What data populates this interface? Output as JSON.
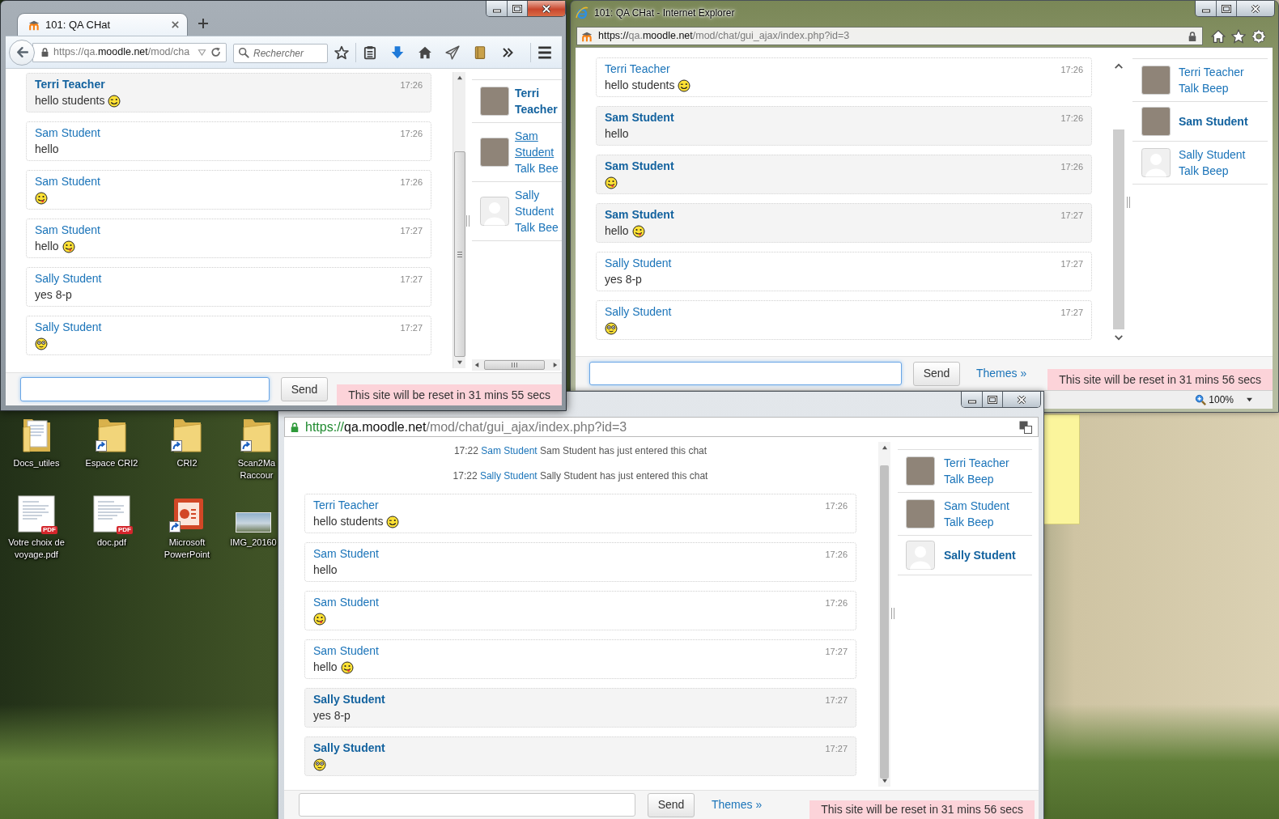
{
  "desktop": {
    "icons": [
      {
        "label": "Docs_utiles",
        "kind": "folder"
      },
      {
        "label": "Espace CRI2",
        "kind": "folder-shortcut"
      },
      {
        "label": "CRI2",
        "kind": "folder-shortcut"
      },
      {
        "label": "Scan2Ma Raccour",
        "kind": "folder-shortcut"
      },
      {
        "label": "Votre choix de voyage.pdf",
        "kind": "pdf",
        "badge": "PDF"
      },
      {
        "label": "doc.pdf",
        "kind": "pdf",
        "badge": "PDF"
      },
      {
        "label": "Microsoft PowerPoint",
        "kind": "presentation-shortcut"
      },
      {
        "label": "IMG_20160",
        "kind": "image"
      }
    ]
  },
  "windows": [
    {
      "kind": "firefox",
      "active": true,
      "tab_title": "101: QA CHat",
      "url": [
        {
          "text": "https://qa.",
          "kind": "dim"
        },
        {
          "text": "moodle.net",
          "kind": "strong"
        },
        {
          "text": "/mod/cha",
          "kind": "dim"
        }
      ],
      "search_placeholder": "Rechercher",
      "messages": [
        {
          "kind": "message",
          "author": "Terri Teacher",
          "time": "17:26",
          "text": "hello students",
          "emoji": {
            "kind": "wink"
          },
          "own": true
        },
        {
          "kind": "message",
          "author": "Sam Student",
          "time": "17:26",
          "text": "hello",
          "own": false
        },
        {
          "kind": "message",
          "author": "Sam Student",
          "time": "17:26",
          "emoji": {
            "kind": "tongue"
          },
          "own": false
        },
        {
          "kind": "message",
          "author": "Sam Student",
          "time": "17:27",
          "text": "hello",
          "emoji": {
            "kind": "tongue"
          },
          "own": false
        },
        {
          "kind": "message",
          "author": "Sally Student",
          "time": "17:27",
          "text": "yes 8-p",
          "own": false
        },
        {
          "kind": "message",
          "author": "Sally Student",
          "time": "17:27",
          "emoji": {
            "kind": "wide-eyed"
          },
          "own": false
        }
      ],
      "users": [
        {
          "name": "Terri Teacher",
          "avatar": {
            "kind": "photo"
          },
          "own": true,
          "hovered": false
        },
        {
          "name": "Sam Student",
          "avatar": {
            "kind": "photo"
          },
          "own": false,
          "hovered": true,
          "actions": [
            "Talk",
            "Bee"
          ]
        },
        {
          "name": "Sally Student",
          "avatar": {
            "kind": "default"
          },
          "own": false,
          "hovered": false,
          "actions": [
            "Talk",
            "Bee"
          ]
        }
      ],
      "input": {
        "focused": true
      },
      "send_label": "Send",
      "reset_notice": "This site will be reset in 31 mins 55 secs"
    },
    {
      "kind": "ie",
      "active": false,
      "title": "101: QA CHat - Internet Explorer",
      "url": [
        {
          "text": "https://",
          "kind": "strong"
        },
        {
          "text": "qa.",
          "kind": "dim"
        },
        {
          "text": "moodle.net",
          "kind": "strong"
        },
        {
          "text": "/mod/chat/gui_ajax/index.php?id=3",
          "kind": "dim"
        }
      ],
      "messages": [
        {
          "kind": "message",
          "author": "Terri Teacher",
          "time": "17:26",
          "text": "hello students",
          "emoji": {
            "kind": "wink"
          },
          "own": false
        },
        {
          "kind": "message",
          "author": "Sam Student",
          "time": "17:26",
          "text": "hello",
          "own": true
        },
        {
          "kind": "message",
          "author": "Sam Student",
          "time": "17:26",
          "emoji": {
            "kind": "tongue"
          },
          "own": true
        },
        {
          "kind": "message",
          "author": "Sam Student",
          "time": "17:27",
          "text": "hello",
          "emoji": {
            "kind": "tongue"
          },
          "own": true
        },
        {
          "kind": "message",
          "author": "Sally Student",
          "time": "17:27",
          "text": "yes 8-p",
          "own": false
        },
        {
          "kind": "message",
          "author": "Sally Student",
          "time": "17:27",
          "emoji": {
            "kind": "wide-eyed"
          },
          "own": false
        }
      ],
      "users": [
        {
          "name": "Terri Teacher",
          "avatar": {
            "kind": "photo"
          },
          "own": false,
          "actions": [
            "Talk",
            "Beep"
          ]
        },
        {
          "name": "Sam Student",
          "avatar": {
            "kind": "photo"
          },
          "own": true
        },
        {
          "name": "Sally Student",
          "avatar": {
            "kind": "default"
          },
          "own": false,
          "actions": [
            "Talk",
            "Beep"
          ]
        }
      ],
      "input": {
        "focused": true
      },
      "send_label": "Send",
      "themes_link": "Themes »",
      "reset_notice": "This site will be reset in 31 mins 56 secs",
      "zoom_level": "100%"
    },
    {
      "kind": "chrome",
      "active": false,
      "url": [
        {
          "text": "https://",
          "kind": "secure"
        },
        {
          "text": "qa.moodle.net",
          "kind": "strong"
        },
        {
          "text": "/mod/chat/gui_ajax/index.php?id=3",
          "kind": "dim"
        }
      ],
      "messages": [
        {
          "kind": "system",
          "time": "17:22",
          "user": "Sam Student",
          "text": "Sam Student has just entered this chat"
        },
        {
          "kind": "system",
          "time": "17:22",
          "user": "Sally Student",
          "text": "Sally Student has just entered this chat"
        },
        {
          "kind": "message",
          "author": "Terri Teacher",
          "time": "17:26",
          "text": "hello students",
          "emoji": {
            "kind": "wink"
          },
          "own": false
        },
        {
          "kind": "message",
          "author": "Sam Student",
          "time": "17:26",
          "text": "hello",
          "own": false
        },
        {
          "kind": "message",
          "author": "Sam Student",
          "time": "17:26",
          "emoji": {
            "kind": "tongue"
          },
          "own": false
        },
        {
          "kind": "message",
          "author": "Sam Student",
          "time": "17:27",
          "text": "hello",
          "emoji": {
            "kind": "tongue"
          },
          "own": false
        },
        {
          "kind": "message",
          "author": "Sally Student",
          "time": "17:27",
          "text": "yes 8-p",
          "own": true
        },
        {
          "kind": "message",
          "author": "Sally Student",
          "time": "17:27",
          "emoji": {
            "kind": "wide-eyed"
          },
          "own": true
        }
      ],
      "users": [
        {
          "name": "Terri Teacher",
          "avatar": {
            "kind": "photo"
          },
          "own": false,
          "actions": [
            "Talk",
            "Beep"
          ]
        },
        {
          "name": "Sam Student",
          "avatar": {
            "kind": "photo"
          },
          "own": false,
          "actions": [
            "Talk",
            "Beep"
          ]
        },
        {
          "name": "Sally Student",
          "avatar": {
            "kind": "default"
          },
          "own": true
        }
      ],
      "input": {
        "focused": false
      },
      "send_label": "Send",
      "themes_link": "Themes »",
      "reset_notice": "This site will be reset in 31 mins 56 secs"
    }
  ]
}
